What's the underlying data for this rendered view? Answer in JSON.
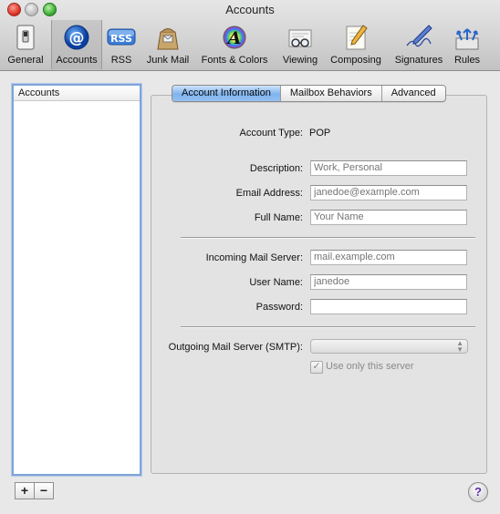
{
  "window": {
    "title": "Accounts"
  },
  "toolbar": {
    "items": [
      {
        "label": "General",
        "icon": "switch-icon"
      },
      {
        "label": "Accounts",
        "icon": "at-sign-icon",
        "selected": true
      },
      {
        "label": "RSS",
        "icon": "rss-icon"
      },
      {
        "label": "Junk Mail",
        "icon": "junk-bag-icon"
      },
      {
        "label": "Fonts & Colors",
        "icon": "font-color-icon"
      },
      {
        "label": "Viewing",
        "icon": "viewing-glasses-icon"
      },
      {
        "label": "Composing",
        "icon": "pencil-paper-icon"
      },
      {
        "label": "Signatures",
        "icon": "signature-pen-icon"
      },
      {
        "label": "Rules",
        "icon": "rules-arrows-icon"
      }
    ]
  },
  "sidebar": {
    "header": "Accounts",
    "add_label": "+",
    "remove_label": "−"
  },
  "tabs": [
    {
      "label": "Account Information",
      "active": true
    },
    {
      "label": "Mailbox Behaviors",
      "active": false
    },
    {
      "label": "Advanced",
      "active": false
    }
  ],
  "form": {
    "account_type_label": "Account Type:",
    "account_type_value": "POP",
    "description_label": "Description:",
    "description_placeholder": "Work, Personal",
    "email_label": "Email Address:",
    "email_placeholder": "janedoe@example.com",
    "fullname_label": "Full Name:",
    "fullname_placeholder": "Your Name",
    "incoming_label": "Incoming Mail Server:",
    "incoming_placeholder": "mail.example.com",
    "username_label": "User Name:",
    "username_placeholder": "janedoe",
    "password_label": "Password:",
    "password_placeholder": "",
    "smtp_label": "Outgoing Mail Server (SMTP):",
    "smtp_value": "",
    "only_server_label": "Use only this server",
    "only_server_checked": true
  },
  "help": {
    "label": "?"
  },
  "colors": {
    "tab_active": "#7fb3ee",
    "list_focus": "#7ea4d8",
    "help_glyph": "#5a2aa8"
  }
}
